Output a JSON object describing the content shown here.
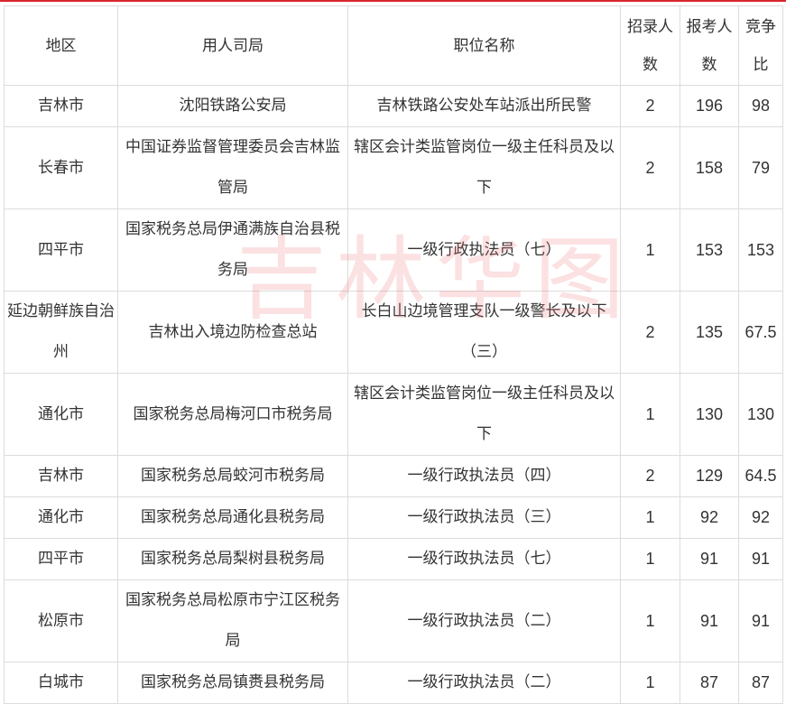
{
  "headers": {
    "region": "地区",
    "employer": "用人司局",
    "position": "职位名称",
    "hires": "招录人数",
    "applicants": "报考人数",
    "ratio": "竞争比"
  },
  "rows": [
    {
      "region": "吉林市",
      "employer": "沈阳铁路公安局",
      "position": "吉林铁路公安处车站派出所民警",
      "hires": "2",
      "applicants": "196",
      "ratio": "98"
    },
    {
      "region": "长春市",
      "employer": "中国证券监督管理委员会吉林监管局",
      "position": "辖区会计类监管岗位一级主任科员及以下",
      "hires": "2",
      "applicants": "158",
      "ratio": "79"
    },
    {
      "region": "四平市",
      "employer": "国家税务总局伊通满族自治县税务局",
      "position": "一级行政执法员（七）",
      "hires": "1",
      "applicants": "153",
      "ratio": "153"
    },
    {
      "region": "延边朝鲜族自治州",
      "employer": "吉林出入境边防检查总站",
      "position": "长白山边境管理支队一级警长及以下（三）",
      "hires": "2",
      "applicants": "135",
      "ratio": "67.5"
    },
    {
      "region": "通化市",
      "employer": "国家税务总局梅河口市税务局",
      "position": "辖区会计类监管岗位一级主任科员及以下",
      "hires": "1",
      "applicants": "130",
      "ratio": "130"
    },
    {
      "region": "吉林市",
      "employer": "国家税务总局蛟河市税务局",
      "position": "一级行政执法员（四）",
      "hires": "2",
      "applicants": "129",
      "ratio": "64.5"
    },
    {
      "region": "通化市",
      "employer": "国家税务总局通化县税务局",
      "position": "一级行政执法员（三）",
      "hires": "1",
      "applicants": "92",
      "ratio": "92"
    },
    {
      "region": "四平市",
      "employer": "国家税务总局梨树县税务局",
      "position": "一级行政执法员（七）",
      "hires": "1",
      "applicants": "91",
      "ratio": "91"
    },
    {
      "region": "松原市",
      "employer": "国家税务总局松原市宁江区税务局",
      "position": "一级行政执法员（二）",
      "hires": "1",
      "applicants": "91",
      "ratio": "91"
    },
    {
      "region": "白城市",
      "employer": "国家税务总局镇赉县税务局",
      "position": "一级行政执法员（二）",
      "hires": "1",
      "applicants": "87",
      "ratio": "87"
    }
  ],
  "watermark": "吉林华图",
  "colors": {
    "accent_line": "#d9262b",
    "border": "#dcdcdc",
    "text": "#333333"
  }
}
